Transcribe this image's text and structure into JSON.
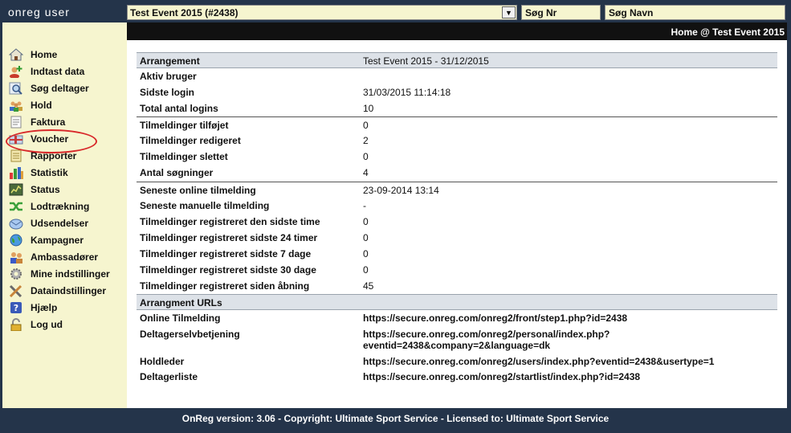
{
  "app": {
    "brand": "onreg user"
  },
  "topbar": {
    "event_selected": "Test Event 2015 (#2438)",
    "search_nr_placeholder": "Søg Nr",
    "search_navn_placeholder": "Søg Navn"
  },
  "content_header": "Home @ Test Event 2015",
  "sidebar": {
    "items": [
      {
        "label": "Home",
        "icon": "house-icon"
      },
      {
        "label": "Indtast data",
        "icon": "add-person-icon"
      },
      {
        "label": "Søg deltager",
        "icon": "magnifier-icon"
      },
      {
        "label": "Hold",
        "icon": "team-icon"
      },
      {
        "label": "Faktura",
        "icon": "invoice-icon"
      },
      {
        "label": "Voucher",
        "icon": "voucher-icon"
      },
      {
        "label": "Rapporter",
        "icon": "report-icon"
      },
      {
        "label": "Statistik",
        "icon": "bar-chart-icon"
      },
      {
        "label": "Status",
        "icon": "status-icon"
      },
      {
        "label": "Lodtrækning",
        "icon": "shuffle-icon"
      },
      {
        "label": "Udsendelser",
        "icon": "mail-icon"
      },
      {
        "label": "Kampagner",
        "icon": "globe-icon"
      },
      {
        "label": "Ambassadører",
        "icon": "ambassador-icon"
      },
      {
        "label": "Mine indstillinger",
        "icon": "gear-icon"
      },
      {
        "label": "Dataindstillinger",
        "icon": "tools-icon"
      },
      {
        "label": "Hjælp",
        "icon": "help-icon"
      },
      {
        "label": "Log ud",
        "icon": "lock-icon"
      }
    ],
    "highlight_color": "#d8282a"
  },
  "info": {
    "arrangement_label": "Arrangement",
    "arrangement_value": "Test Event 2015 - 31/12/2015",
    "aktiv_bruger_label": "Aktiv bruger",
    "sidste_login_label": "Sidste login",
    "sidste_login_value": "31/03/2015 11:14:18",
    "total_logins_label": "Total antal logins",
    "total_logins_value": "10",
    "tilfojet_label": "Tilmeldinger tilføjet",
    "tilfojet_value": "0",
    "redigeret_label": "Tilmeldinger redigeret",
    "redigeret_value": "2",
    "slettet_label": "Tilmeldinger slettet",
    "slettet_value": "0",
    "sogninger_label": "Antal søgninger",
    "sogninger_value": "4",
    "seneste_online_label": "Seneste online tilmelding",
    "seneste_online_value": "23-09-2014 13:14",
    "seneste_manuelle_label": "Seneste manuelle tilmelding",
    "seneste_manuelle_value": "-",
    "reg_time_label": "Tilmeldinger registreret den sidste time",
    "reg_time_value": "0",
    "reg_24_label": "Tilmeldinger registreret sidste 24 timer",
    "reg_24_value": "0",
    "reg_7_label": "Tilmeldinger registreret sidste 7 dage",
    "reg_7_value": "0",
    "reg_30_label": "Tilmeldinger registreret sidste 30 dage",
    "reg_30_value": "0",
    "reg_open_label": "Tilmeldinger registreret siden åbning",
    "reg_open_value": "45"
  },
  "urls": {
    "section_label": "Arrangment URLs",
    "online_label": "Online Tilmelding",
    "online_url": "https://secure.onreg.com/onreg2/front/step1.php?id=2438",
    "selvbetjening_label": "Deltagerselvbetjening",
    "selvbetjening_url_line1": "https://secure.onreg.com/onreg2/personal/index.php?",
    "selvbetjening_url_line2": "eventid=2438&company=2&language=dk",
    "holdleder_label": "Holdleder",
    "holdleder_url": "https://secure.onreg.com/onreg2/users/index.php?eventid=2438&usertype=1",
    "deltagerliste_label": "Deltagerliste",
    "deltagerliste_url": "https://secure.onreg.com/onreg2/startlist/index.php?id=2438"
  },
  "footer": "OnReg version: 3.06 - Copyright: Ultimate Sport Service - Licensed to: Ultimate Sport Service"
}
